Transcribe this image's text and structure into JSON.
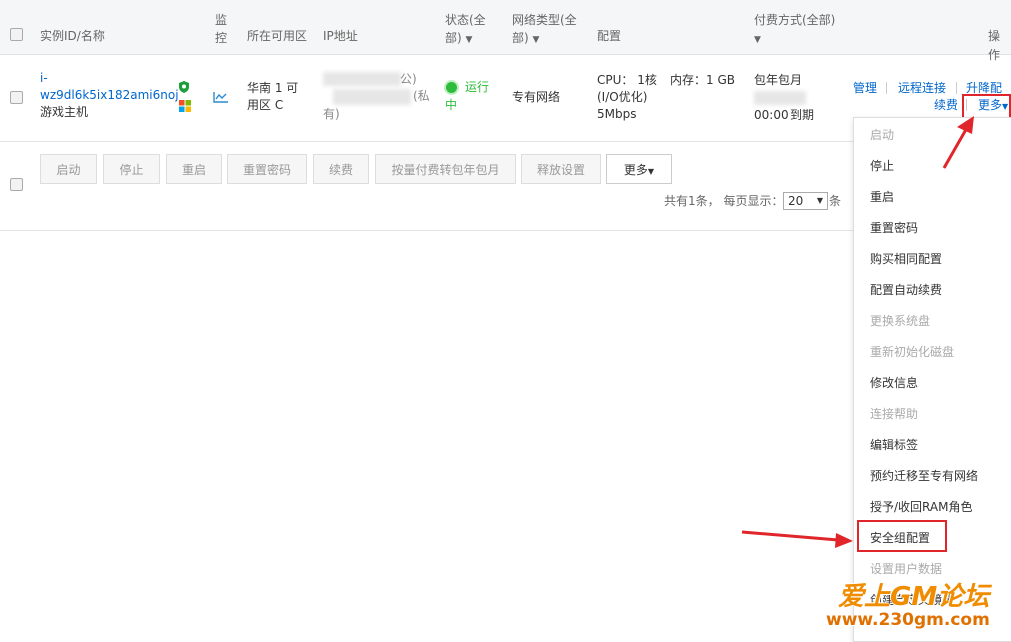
{
  "header": {
    "id_name": "实例ID/名称",
    "monitor_1": "监",
    "monitor_2": "控",
    "zone": "所在可用区",
    "ip": "IP地址",
    "status_1": "状态(全",
    "status_2": "部)",
    "network_1": "网络类型(全",
    "network_2": "部)",
    "config": "配置",
    "billing": "付费方式(全部)",
    "ops": "操作"
  },
  "instance": {
    "id_1": "i-",
    "id_2": "wz9dl6k5ix182ami6noj",
    "name": "游戏主机",
    "zone_1": "华南 1 可",
    "zone_2": "用区 C",
    "ip_public_suffix": "公)",
    "ip_private_suffix": "(私",
    "ip_private_end": "有)",
    "status_1": "运行",
    "status_2": "中",
    "network": "专有网络",
    "cpu": "CPU： 1核",
    "memory": "内存：1 GB",
    "io": "(I/O优化)",
    "bandwidth": "5Mbps",
    "billing_type": "包年包月",
    "expire_time": "00:00",
    "expire_label": "到期",
    "ops": {
      "manage": "管理",
      "remote": "远程连接",
      "upgrade": "升降配",
      "renew": "续费",
      "more": "更多"
    }
  },
  "toolbar": {
    "buttons": [
      "启动",
      "停止",
      "重启",
      "重置密码",
      "续费",
      "按量付费转包年包月",
      "释放设置"
    ],
    "more": "更多"
  },
  "pagination": {
    "total_text": "共有1条， 每页显示：",
    "page_size": "20",
    "unit": "条"
  },
  "menu": {
    "items": [
      {
        "label": "启动",
        "enabled": false
      },
      {
        "label": "停止",
        "enabled": true
      },
      {
        "label": "重启",
        "enabled": true
      },
      {
        "label": "重置密码",
        "enabled": true
      },
      {
        "label": "购买相同配置",
        "enabled": true
      },
      {
        "label": "配置自动续费",
        "enabled": true
      },
      {
        "label": "更换系统盘",
        "enabled": false
      },
      {
        "label": "重新初始化磁盘",
        "enabled": false
      },
      {
        "label": "修改信息",
        "enabled": true
      },
      {
        "label": "连接帮助",
        "enabled": false
      },
      {
        "label": "编辑标签",
        "enabled": true
      },
      {
        "label": "预约迁移至专有网络",
        "enabled": true
      },
      {
        "label": "授予/收回RAM角色",
        "enabled": true
      },
      {
        "label": "安全组配置",
        "enabled": true
      },
      {
        "label": "设置用户数据",
        "enabled": false
      },
      {
        "label": "创建自定义镜像",
        "enabled": true
      }
    ]
  },
  "watermark": {
    "line1": "爱上GM论坛",
    "line2": "www.230gm.com"
  },
  "colors": {
    "link": "#0066cc",
    "status_green": "#2dbd3b",
    "highlight_red": "#e0252b",
    "watermark_orange": "#f08c00"
  }
}
